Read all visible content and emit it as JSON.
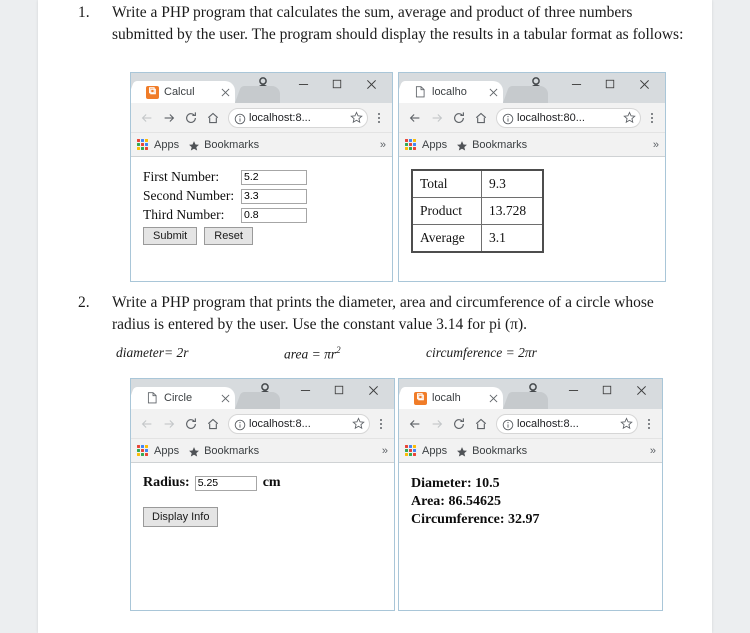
{
  "questions": [
    {
      "number": "1.",
      "text": "Write a PHP program that calculates the sum, average and product of three numbers submitted by the user. The program should display the results in a tabular format as follows:"
    },
    {
      "number": "2.",
      "text": "Write a PHP program that prints the diameter, area and circumference of a circle whose radius is entered by the user. Use the constant value 3.14 for pi (π)."
    }
  ],
  "formulas": {
    "diameter": "diameter= 2r",
    "area_prefix": "area = πr",
    "area_exponent": "2",
    "circumference": "circumference = 2πr"
  },
  "browser_common": {
    "bookmarks_apps_label": "Apps",
    "bookmarks_label": "Bookmarks",
    "overflow_label": "»",
    "tab_close_label": "×",
    "minimize_label": "—",
    "maximize_label": "□",
    "close_label": "✕",
    "icons": {
      "profile": "profile-icon",
      "back": "back-arrow-icon",
      "forward": "forward-arrow-icon",
      "reload": "reload-icon",
      "home": "home-icon",
      "info": "info-circle-icon",
      "star": "star-icon",
      "menu": "three-dot-menu-icon",
      "apps": "apps-grid-icon"
    }
  },
  "windows": [
    {
      "id": "browser-1",
      "tab_title": "Calcul",
      "favicon": "xampp-icon",
      "favicon_glyph": "⧉",
      "url": "localhost:8...",
      "back_enabled": false,
      "forward_enabled": true,
      "content": {
        "type": "form",
        "rows": [
          {
            "label": "First Number:",
            "value": "5.2"
          },
          {
            "label": "Second Number:",
            "value": "3.3"
          },
          {
            "label": "Third Number:",
            "value": "0.8"
          }
        ],
        "submit_label": "Submit",
        "reset_label": "Reset"
      }
    },
    {
      "id": "browser-2",
      "tab_title": "localho",
      "favicon": "document-icon",
      "url": "localhost:80...",
      "back_enabled": true,
      "forward_enabled": false,
      "content": {
        "type": "table",
        "rows": [
          {
            "label": "Total",
            "value": "9.3"
          },
          {
            "label": "Product",
            "value": "13.728"
          },
          {
            "label": "Average",
            "value": "3.1"
          }
        ]
      }
    },
    {
      "id": "browser-3",
      "tab_title": "Circle",
      "favicon": "document-icon",
      "url": "localhost:8...",
      "back_enabled": false,
      "forward_enabled": false,
      "content": {
        "type": "radius-form",
        "label": "Radius:",
        "value": "5.25",
        "unit": "cm",
        "button_label": "Display Info"
      }
    },
    {
      "id": "browser-4",
      "tab_title": "localh",
      "favicon": "xampp-icon",
      "favicon_glyph": "⧉",
      "url": "localhost:8...",
      "back_enabled": true,
      "forward_enabled": false,
      "content": {
        "type": "results",
        "lines": [
          "Diameter: 10.5",
          "Area: 86.54625",
          "Circumference: 32.97"
        ]
      }
    }
  ]
}
